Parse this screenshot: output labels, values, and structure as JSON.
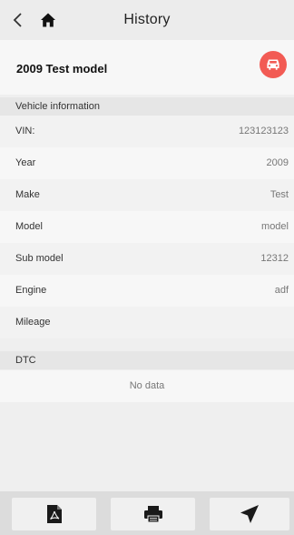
{
  "header": {
    "title": "History",
    "back_icon": "chevron-left-icon",
    "home_icon": "home-icon"
  },
  "record": {
    "title": "2009 Test model",
    "badge_icon": "car-icon",
    "badge_color": "#f25b54"
  },
  "vehicle_info": {
    "section_label": "Vehicle information",
    "rows": [
      {
        "label": "VIN:",
        "value": "123123123"
      },
      {
        "label": "Year",
        "value": "2009"
      },
      {
        "label": "Make",
        "value": "Test"
      },
      {
        "label": "Model",
        "value": "model"
      },
      {
        "label": "Sub model",
        "value": "12312"
      },
      {
        "label": "Engine",
        "value": "adf"
      },
      {
        "label": "Mileage",
        "value": ""
      }
    ]
  },
  "dtc": {
    "section_label": "DTC",
    "empty_text": "No data"
  },
  "toolbar": {
    "pdf_icon": "pdf-icon",
    "print_icon": "printer-icon",
    "send_icon": "send-icon"
  }
}
